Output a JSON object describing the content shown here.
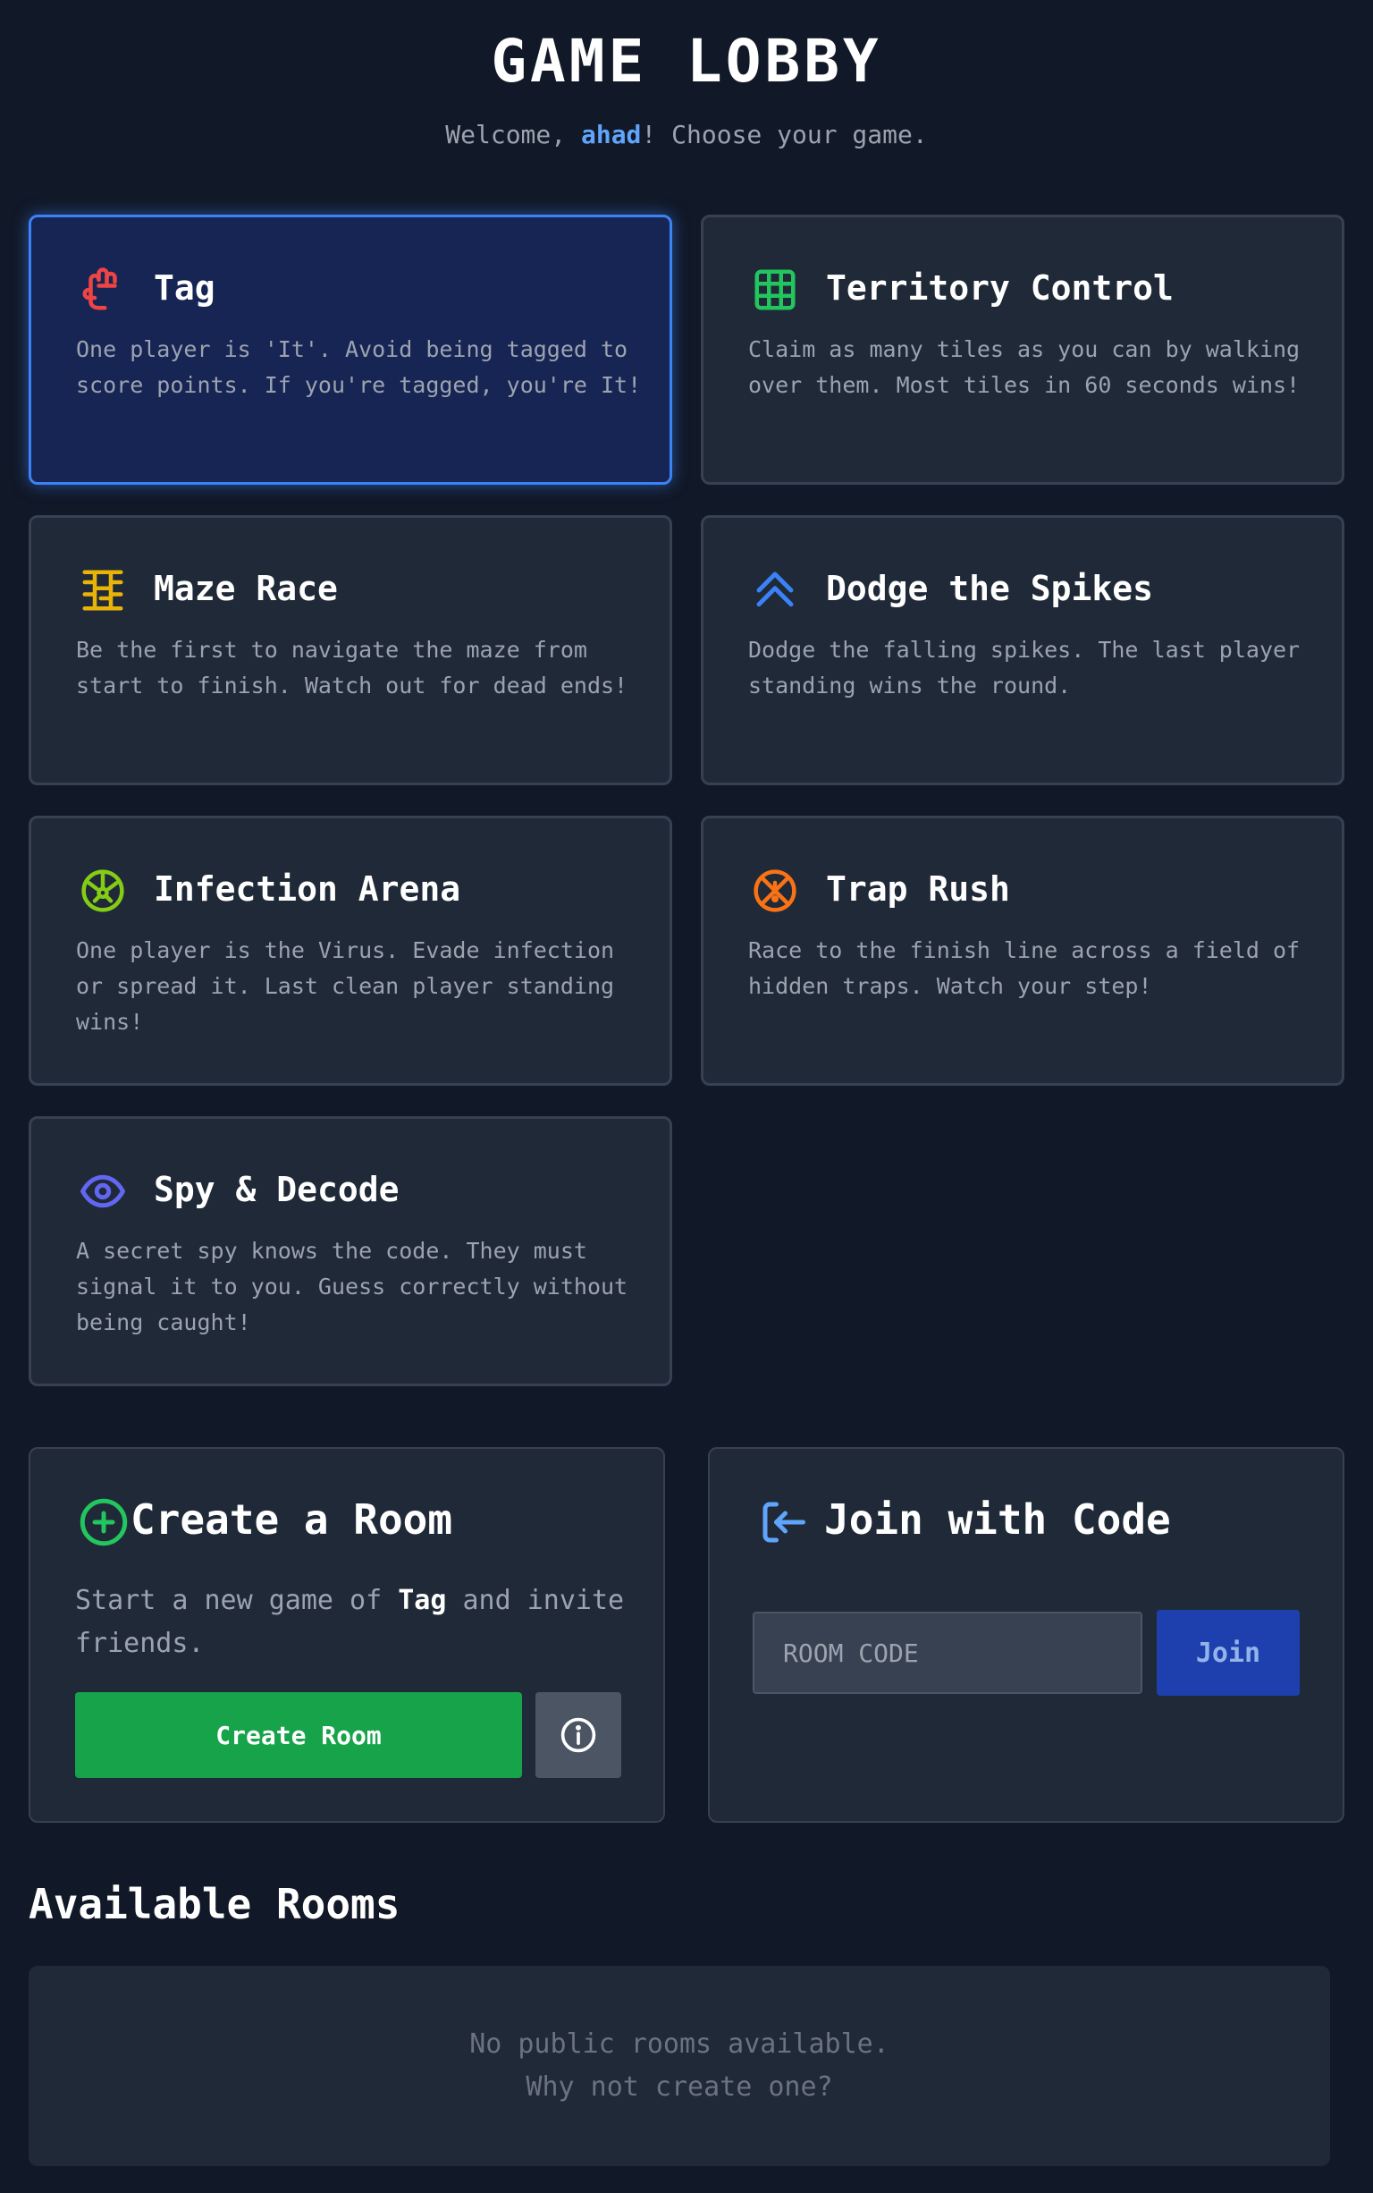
{
  "header": {
    "title": "GAME LOBBY",
    "welcome_prefix": "Welcome, ",
    "username": "ahad",
    "welcome_suffix": "! Choose your game."
  },
  "games": [
    {
      "title": "Tag",
      "icon": "hand-icon",
      "color": "#ef4444",
      "selected": true,
      "description": "One player is 'It'. Avoid being tagged to score points. If you're tagged, you're It!"
    },
    {
      "title": "Territory Control",
      "icon": "grid-icon",
      "color": "#22c55e",
      "selected": false,
      "description": "Claim as many tiles as you can by walking over them. Most tiles in 60 seconds wins!"
    },
    {
      "title": "Maze Race",
      "icon": "maze-icon",
      "color": "#eab308",
      "selected": false,
      "description": "Be the first to navigate the maze from start to finish. Watch out for dead ends!"
    },
    {
      "title": "Dodge the Spikes",
      "icon": "double-chevron-up-icon",
      "color": "#3b82f6",
      "selected": false,
      "description": "Dodge the falling spikes. The last player standing wins the round."
    },
    {
      "title": "Infection Arena",
      "icon": "virus-icon",
      "color": "#84cc16",
      "selected": false,
      "description": "One player is the Virus. Evade infection or spread it. Last clean player standing wins!"
    },
    {
      "title": "Trap Rush",
      "icon": "trap-icon",
      "color": "#f97316",
      "selected": false,
      "description": "Race to the finish line across a field of hidden traps. Watch your step!"
    },
    {
      "title": "Spy & Decode",
      "icon": "eye-icon",
      "color": "#6366f1",
      "selected": false,
      "description": "A secret spy knows the code. They must signal it to you. Guess correctly without being caught!"
    }
  ],
  "create_room": {
    "title": "Create a Room",
    "desc_prefix": "Start a new game of ",
    "selected_game": "Tag",
    "desc_suffix": " and invite friends.",
    "button_label": "Create Room",
    "icon": "plus-circle-icon",
    "icon_color": "#22c55e",
    "button_color": "#16a34a"
  },
  "join_room": {
    "title": "Join with Code",
    "icon": "enter-icon",
    "icon_color": "#60a5fa",
    "input_placeholder": "ROOM CODE",
    "input_value": "",
    "button_label": "Join"
  },
  "available_rooms": {
    "title": "Available Rooms",
    "empty_line1": "No public rooms available.",
    "empty_line2": "Why not create one?"
  }
}
